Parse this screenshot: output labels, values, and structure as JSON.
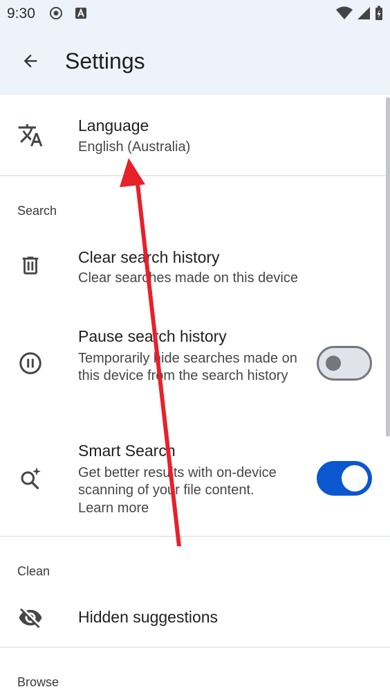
{
  "status": {
    "time": "9:30"
  },
  "app_bar": {
    "title": "Settings"
  },
  "language": {
    "title": "Language",
    "value": "English (Australia)"
  },
  "search_section": {
    "header": "Search",
    "clear_history": {
      "title": "Clear search history",
      "subtitle": "Clear searches made on this device"
    },
    "pause_history": {
      "title": "Pause search history",
      "subtitle": "Temporarily hide searches made on this device from the search history",
      "enabled": false
    },
    "smart_search": {
      "title": "Smart Search",
      "subtitle": "Get better results with on-device scanning of your file content.",
      "link": "Learn more",
      "enabled": true
    }
  },
  "clean_section": {
    "header": "Clean",
    "hidden_suggestions": {
      "title": "Hidden suggestions"
    }
  },
  "browse_section": {
    "header": "Browse"
  },
  "colors": {
    "app_bar_bg": "#eef2fb",
    "accent": "#0b57d0",
    "annotation_arrow": "#e8202a"
  }
}
